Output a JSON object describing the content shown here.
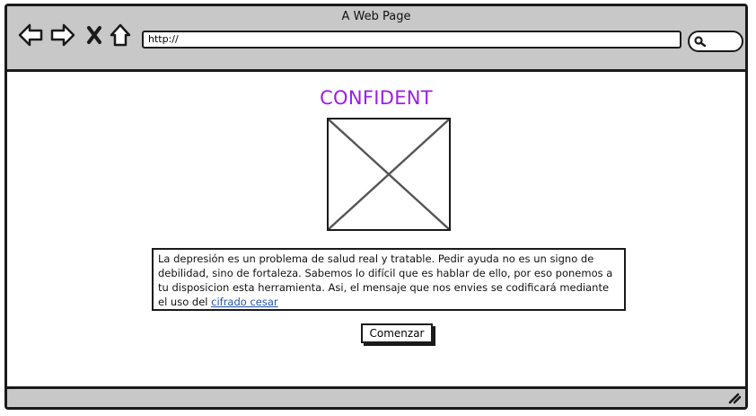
{
  "window": {
    "title": "A Web Page"
  },
  "address_bar": {
    "url": "http://"
  },
  "icons": {
    "back": "back-arrow-icon",
    "forward": "forward-arrow-icon",
    "stop": "close-icon",
    "home": "home-icon",
    "search": "search-icon",
    "image": "image-placeholder-icon",
    "resize": "resize-grip-icon"
  },
  "colors": {
    "heading": "#9b1ee6",
    "link": "#2255aa",
    "chrome": "#c8c8c8"
  },
  "main": {
    "heading": "CONFIDENT",
    "description": "La depresión es un problema de salud real y tratable. Pedir ayuda no es un signo de debilidad, sino de fortaleza. Sabemos lo difícil que es hablar de ello, por eso ponemos a tu disposicion esta herramienta. Asi, el mensaje que nos envies se codificará mediante el uso del",
    "link_text": "cifrado cesar",
    "start_button": "Comenzar"
  }
}
